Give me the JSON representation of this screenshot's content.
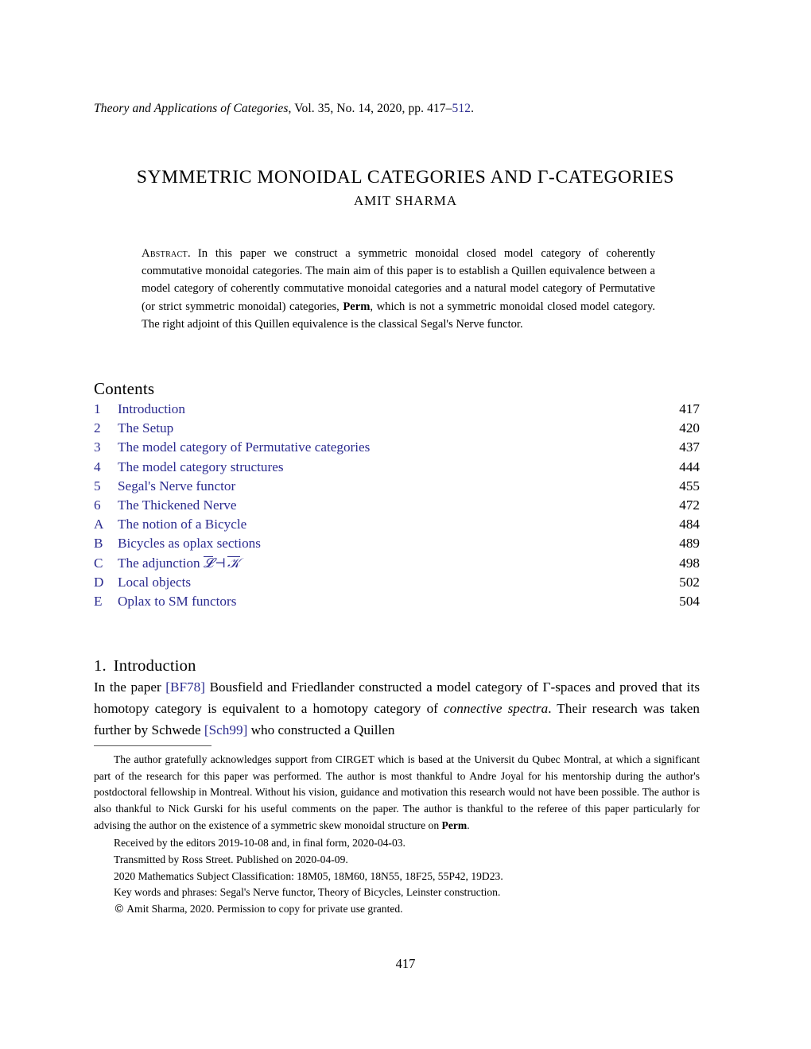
{
  "journal": {
    "name": "Theory and Applications of Categories",
    "volume_label": ", Vol. 35, No. 14, 2020, pp. 417–",
    "page_range_end": "512",
    "trailing": "."
  },
  "title": "SYMMETRIC MONOIDAL CATEGORIES AND Γ-CATEGORIES",
  "author": "AMIT SHARMA",
  "abstract": {
    "label": "Abstract.",
    "part1": "In this paper we construct a symmetric monoidal closed model category of coherently commutative monoidal categories. The main aim of this paper is to establish a Quillen equivalence between a model category of coherently commutative monoidal categories and a natural model category of Permutative (or strict symmetric monoidal) categories, ",
    "bold_term": "Perm",
    "part2": ", which is not a symmetric monoidal closed model category. The right adjoint of this Quillen equivalence is the classical Segal's Nerve functor."
  },
  "contents": {
    "heading": "Contents",
    "entries": [
      {
        "num": "1",
        "label": "Introduction",
        "page": "417"
      },
      {
        "num": "2",
        "label": "The Setup",
        "page": "420"
      },
      {
        "num": "3",
        "label": "The model category of Permutative categories",
        "page": "437"
      },
      {
        "num": "4",
        "label": "The model category structures",
        "page": "444"
      },
      {
        "num": "5",
        "label": "Segal's Nerve functor",
        "page": "455"
      },
      {
        "num": "6",
        "label": "The Thickened Nerve",
        "page": "472"
      },
      {
        "num": "A",
        "label": "The notion of a Bicycle",
        "page": "484"
      },
      {
        "num": "B",
        "label": "Bicycles as oplax sections",
        "page": "489"
      },
      {
        "num": "C",
        "label": "The adjunction",
        "page": "498",
        "math": {
          "left": "𝓛",
          "relation": "⊣",
          "right": "𝒦"
        }
      },
      {
        "num": "D",
        "label": "Local objects",
        "page": "502"
      },
      {
        "num": "E",
        "label": "Oplax to SM functors",
        "page": "504"
      }
    ]
  },
  "section": {
    "number": "1.",
    "heading": "Introduction",
    "paragraph": {
      "seg1": "In the paper ",
      "cite1": "[BF78]",
      "seg2": " Bousfield and Friedlander constructed a model category of Γ-spaces and proved that its homotopy category is equivalent to a homotopy category of ",
      "italic1": "connective spectra",
      "seg3": ". Their research was taken further by Schwede ",
      "cite2": "[Sch99]",
      "seg4": " who constructed a Quillen"
    }
  },
  "footnote": {
    "ack_part1": "The author gratefully acknowledges support from CIRGET which is based at the Universit du Qubec Montral, at which a significant part of the research for this paper was performed. The author is most thankful to Andre Joyal for his mentorship during the author's postdoctoral fellowship in Montreal. Without his vision, guidance and motivation this research would not have been possible. The author is also thankful to Nick Gurski for his useful comments on the paper. The author is thankful to the referee of this paper particularly for advising the author on the existence of a symmetric skew monoidal structure on ",
    "ack_bold": "Perm",
    "ack_part2": ".",
    "received": "Received by the editors 2019-10-08 and, in final form, 2020-04-03.",
    "transmitted": "Transmitted by Ross Street. Published on 2020-04-09.",
    "msc": "2020 Mathematics Subject Classification: 18M05, 18M60, 18N55, 18F25, 55P42, 19D23.",
    "keywords": "Key words and phrases: Segal's Nerve functor, Theory of Bicycles, Leinster construction.",
    "copyright_symbol": "©",
    "copyright": " Amit Sharma, 2020. Permission to copy for private use granted."
  },
  "folio": "417",
  "colors": {
    "link": "#2b2b8f",
    "text": "#000000",
    "rule": "#555555",
    "background": "#ffffff"
  }
}
